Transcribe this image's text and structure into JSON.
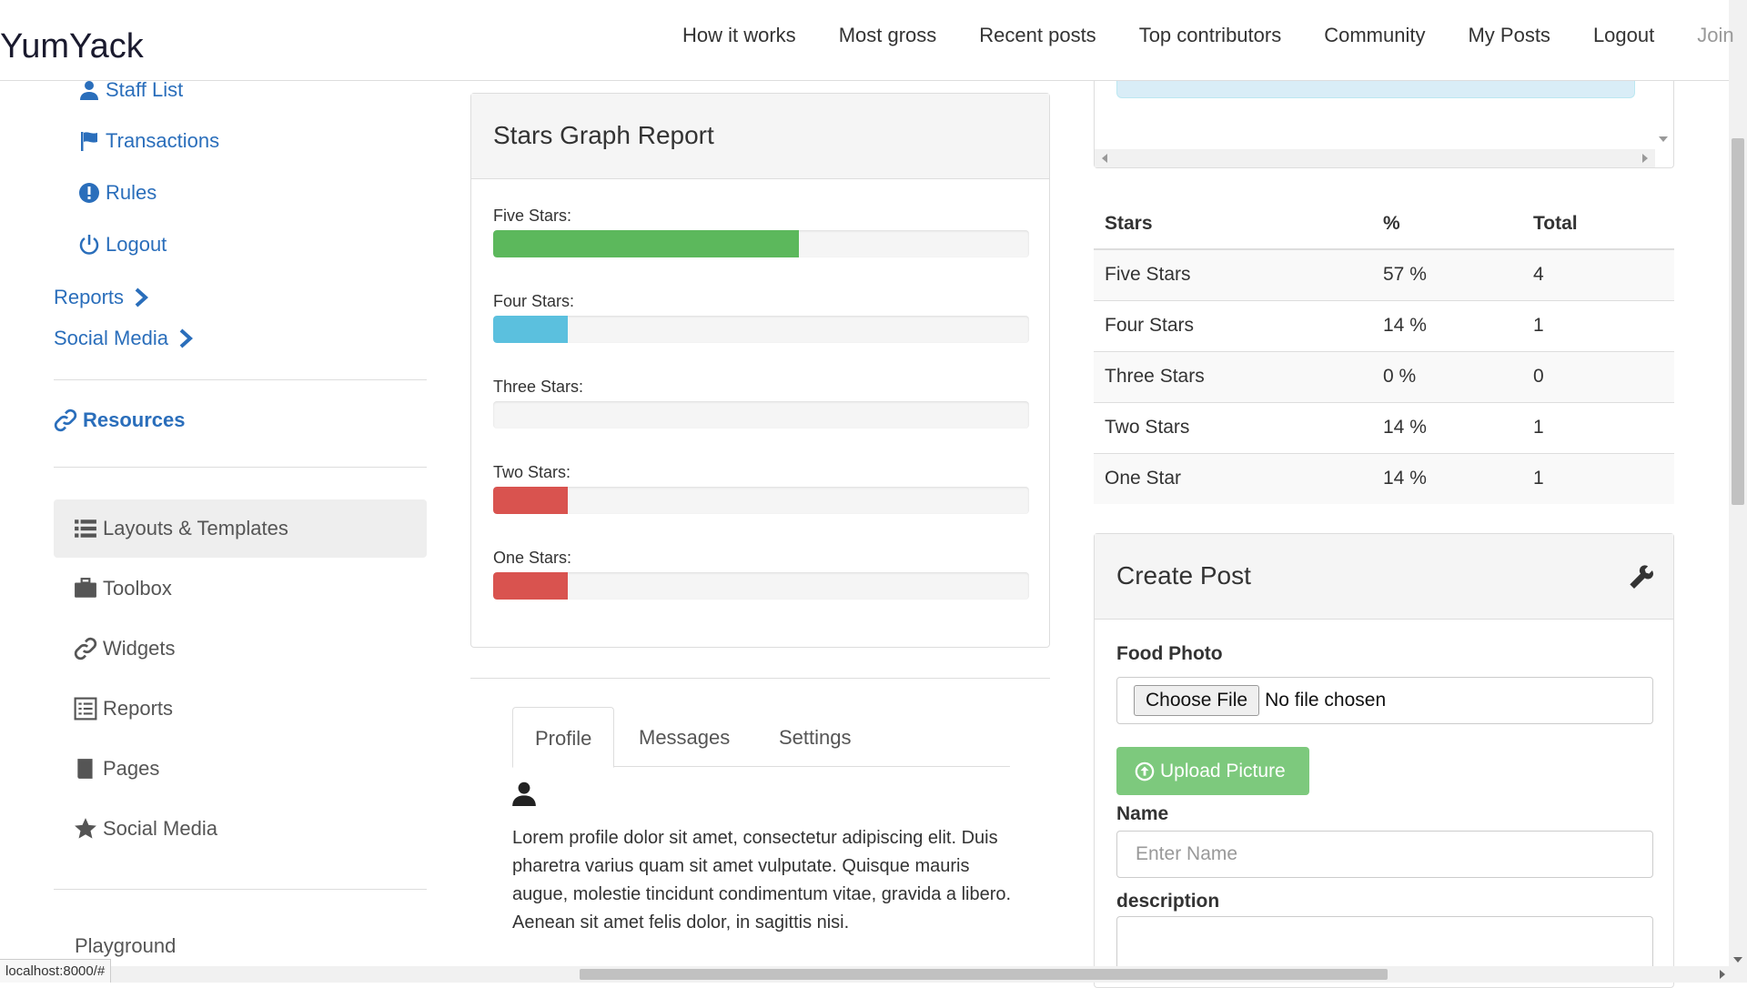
{
  "navbar": {
    "brand": "YumYack",
    "links": [
      "How it works",
      "Most gross",
      "Recent posts",
      "Top contributors",
      "Community",
      "My Posts",
      "Logout",
      "Join"
    ]
  },
  "sidebar": {
    "sub_items": [
      {
        "label": "Staff List",
        "icon": "user-icon"
      },
      {
        "label": "Transactions",
        "icon": "flag-icon"
      },
      {
        "label": "Rules",
        "icon": "exclamation-icon"
      },
      {
        "label": "Logout",
        "icon": "power-icon"
      }
    ],
    "sections": [
      {
        "label": "Reports",
        "icon": "chevron-right-icon"
      },
      {
        "label": "Social Media",
        "icon": "chevron-right-icon"
      }
    ],
    "resources_label": "Resources",
    "menu": [
      {
        "label": "Layouts & Templates",
        "icon": "list-icon",
        "active": true
      },
      {
        "label": "Toolbox",
        "icon": "briefcase-icon"
      },
      {
        "label": "Widgets",
        "icon": "link-icon"
      },
      {
        "label": "Reports",
        "icon": "list-alt-icon"
      },
      {
        "label": "Pages",
        "icon": "book-icon"
      },
      {
        "label": "Social Media",
        "icon": "star-icon"
      }
    ],
    "playground": "Playground"
  },
  "stars_graph": {
    "title": "Stars Graph Report",
    "bars": [
      {
        "label": "Five Stars:",
        "percent": 57,
        "color": "#5cb85c"
      },
      {
        "label": "Four Stars:",
        "percent": 14,
        "color": "#5bc0de"
      },
      {
        "label": "Three Stars:",
        "percent": 0,
        "color": "#5bc0de"
      },
      {
        "label": "Two Stars:",
        "percent": 14,
        "color": "#d9534f"
      },
      {
        "label": "One Stars:",
        "percent": 14,
        "color": "#d9534f"
      }
    ]
  },
  "tabs": {
    "items": [
      "Profile",
      "Messages",
      "Settings"
    ],
    "active": "Profile",
    "profile_text": "Lorem profile dolor sit amet, consectetur adipiscing elit. Duis pharetra varius quam sit amet vulputate. Quisque mauris augue, molestie tincidunt condimentum vitae, gravida a libero. Aenean sit amet felis dolor, in sagittis nisi."
  },
  "stars_table": {
    "headers": [
      "Stars",
      "%",
      "Total"
    ],
    "rows": [
      [
        "Five Stars",
        "57 %",
        "4"
      ],
      [
        "Four Stars",
        "14 %",
        "1"
      ],
      [
        "Three Stars",
        "0 %",
        "0"
      ],
      [
        "Two Stars",
        "14 %",
        "1"
      ],
      [
        "One Star",
        "14 %",
        "1"
      ]
    ]
  },
  "create_post": {
    "title": "Create Post",
    "food_photo_label": "Food Photo",
    "choose_file": "Choose File",
    "file_status": "No file chosen",
    "upload_button": "Upload Picture",
    "name_label": "Name",
    "name_placeholder": "Enter Name",
    "description_label": "description"
  },
  "status_url": "localhost:8000/#"
}
